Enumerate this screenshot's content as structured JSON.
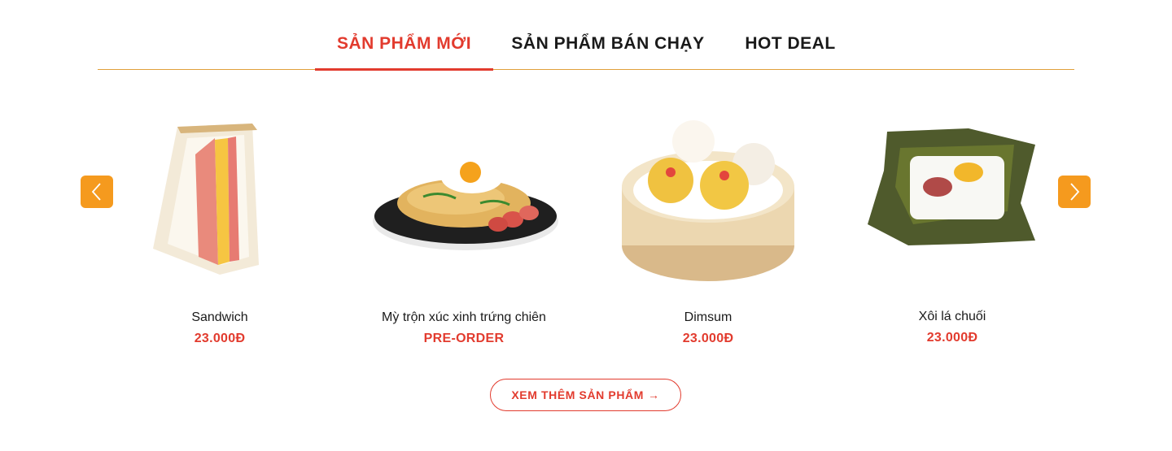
{
  "tabs": [
    {
      "label": "SẢN PHẨM MỚI",
      "active": true
    },
    {
      "label": "SẢN PHẨM BÁN CHẠY",
      "active": false
    },
    {
      "label": "HOT DEAL",
      "active": false
    }
  ],
  "carousel": {
    "prev_icon": "chevron-left-icon",
    "next_icon": "chevron-right-icon"
  },
  "products": [
    {
      "name": "Sandwich",
      "price": "23.000Đ",
      "image": "sandwich"
    },
    {
      "name": "Mỳ trộn xúc xinh trứng chiên",
      "price": "PRE-ORDER",
      "image": "fried-noodles"
    },
    {
      "name": "Dimsum",
      "price": "23.000Đ",
      "image": "dimsum"
    },
    {
      "name": "Xôi lá chuối",
      "price": "23.000Đ",
      "image": "sticky-rice"
    }
  ],
  "more_button": {
    "label": "XEM THÊM SẢN PHẨM",
    "icon": "arrow-right-icon",
    "glyph": "→"
  },
  "colors": {
    "accent": "#e23b2e",
    "arrow_bg": "#f59a1e",
    "divider": "#e0a03a"
  }
}
